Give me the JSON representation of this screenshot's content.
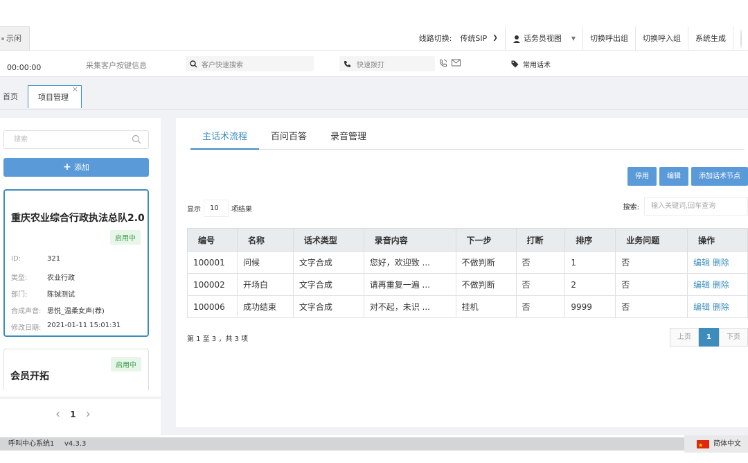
{
  "topbar": {
    "status": "示闲",
    "line_label": "线路切换:",
    "line_value": "传统SIP",
    "agent_view": "话务员视图",
    "switch_out": "切换呼出组",
    "switch_in": "切换呼入组",
    "system_gen": "系统生成"
  },
  "secbar": {
    "timer": "00:00:00",
    "keys_info": "采集客户按键信息",
    "search_placeholder": "客户快速搜索",
    "dial_placeholder": "快速拨打",
    "scripts": "常用话术"
  },
  "tabs": {
    "home": "首页",
    "project": "项目管理",
    "close": "×"
  },
  "sidebar": {
    "search_placeholder": "搜索",
    "add_label": "添加",
    "card1": {
      "title": "重庆农业综合行政执法总队2.0",
      "status": "启用中",
      "rows": [
        {
          "label": "ID:",
          "value": "321"
        },
        {
          "label": "类型:",
          "value": "农业行政"
        },
        {
          "label": "部门:",
          "value": "陈铖测试"
        },
        {
          "label": "合成声音:",
          "value": "思悦_温柔女声(荐)"
        },
        {
          "label": "修改日期:",
          "value": "2021-01-11 15:01:31"
        }
      ]
    },
    "card2": {
      "title": "会员开拓",
      "status": "启用中"
    },
    "pager": {
      "prev": "‹",
      "current": "1",
      "next": "›"
    }
  },
  "content": {
    "tabs": [
      "主话术流程",
      "百问百答",
      "录音管理"
    ],
    "buttons": {
      "disable": "停用",
      "edit": "编辑",
      "add_node": "添加话术节点"
    },
    "show_prefix": "显示",
    "show_value": "10",
    "show_suffix": "项结果",
    "search_label": "搜索:",
    "search_placeholder": "输入关键词,回车查询",
    "columns": [
      "编号",
      "名称",
      "话术类型",
      "录音内容",
      "下一步",
      "打断",
      "排序",
      "业务问题",
      "操作"
    ],
    "rows": [
      {
        "id": "100001",
        "name": "问候",
        "type": "文字合成",
        "audio": "您好，欢迎致 ...",
        "next": "不做判断",
        "interrupt": "否",
        "order": "1",
        "biz": "否",
        "edit": "编辑",
        "delete": "删除"
      },
      {
        "id": "100002",
        "name": "开场白",
        "type": "文字合成",
        "audio": "请再重复一遍 ...",
        "next": "不做判断",
        "interrupt": "否",
        "order": "2",
        "biz": "否",
        "edit": "编辑",
        "delete": "删除"
      },
      {
        "id": "100006",
        "name": "成功结束",
        "type": "文字合成",
        "audio": "对不起，未识 ...",
        "next": "挂机",
        "interrupt": "否",
        "order": "9999",
        "biz": "否",
        "edit": "编辑",
        "delete": "删除"
      }
    ],
    "summary": "第 1 至 3 ，共 3 项",
    "pager": {
      "prev": "上页",
      "current": "1",
      "next": "下页"
    }
  },
  "footer": {
    "system": "呼叫中心系统1",
    "version": "v4.3.3",
    "language": "简体中文"
  },
  "colors": {
    "accent": "#3c8dbc",
    "button": "#5a9ad8",
    "badge_bg": "#e7f6e9",
    "badge_text": "#3a9d4c"
  }
}
